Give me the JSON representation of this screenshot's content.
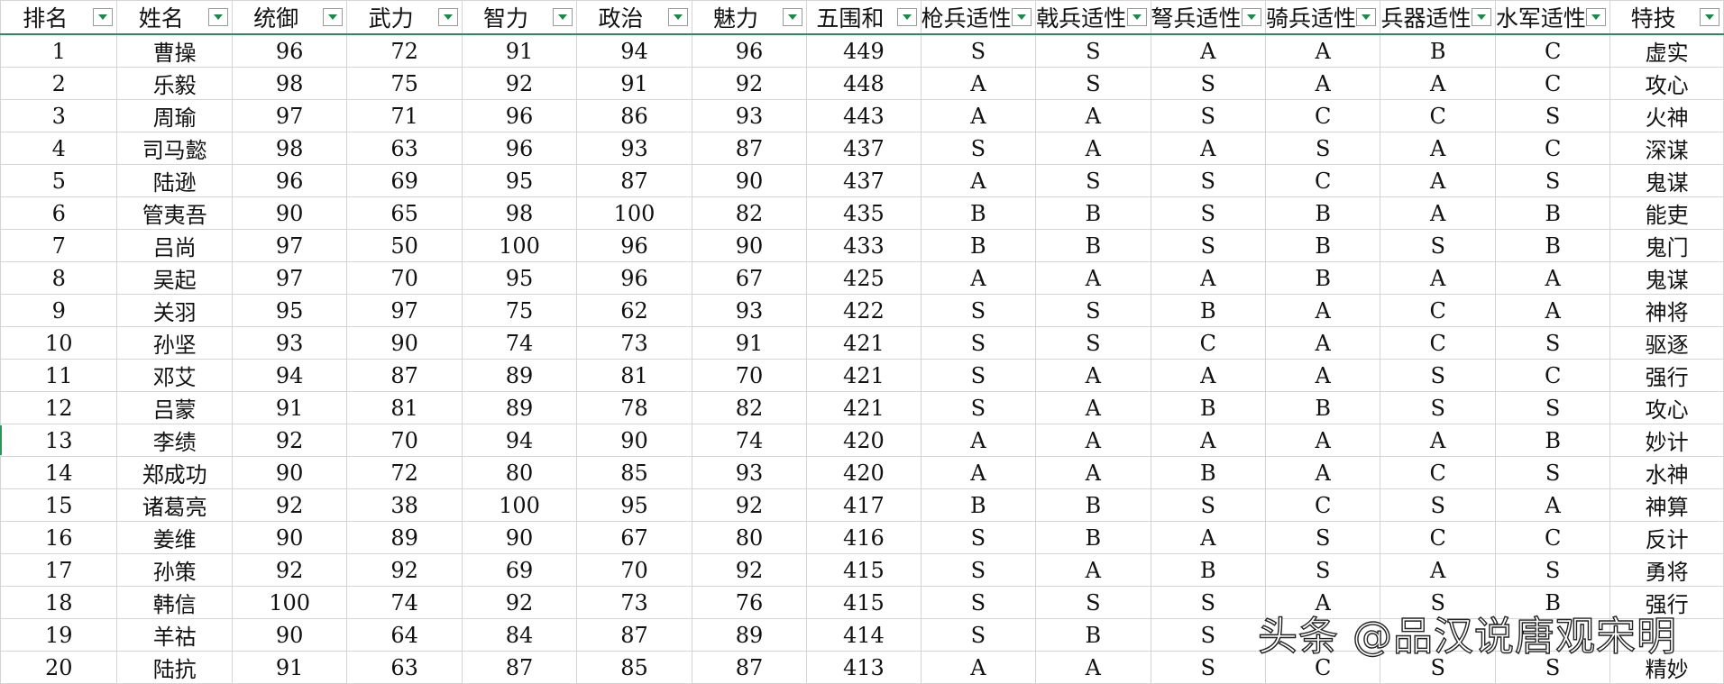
{
  "headers": [
    "排名",
    "姓名",
    "统御",
    "武力",
    "智力",
    "政治",
    "魅力",
    "五围和",
    "枪兵适性",
    "戟兵适性",
    "弩兵适性",
    "骑兵适性",
    "兵器适性",
    "水军适性",
    "特技"
  ],
  "rows": [
    [
      "1",
      "曹操",
      "96",
      "72",
      "91",
      "94",
      "96",
      "449",
      "S",
      "S",
      "A",
      "A",
      "B",
      "C",
      "虚实"
    ],
    [
      "2",
      "乐毅",
      "98",
      "75",
      "92",
      "91",
      "92",
      "448",
      "A",
      "S",
      "S",
      "A",
      "A",
      "C",
      "攻心"
    ],
    [
      "3",
      "周瑜",
      "97",
      "71",
      "96",
      "86",
      "93",
      "443",
      "A",
      "A",
      "S",
      "C",
      "C",
      "S",
      "火神"
    ],
    [
      "4",
      "司马懿",
      "98",
      "63",
      "96",
      "93",
      "87",
      "437",
      "S",
      "A",
      "A",
      "S",
      "A",
      "C",
      "深谋"
    ],
    [
      "5",
      "陆逊",
      "96",
      "69",
      "95",
      "87",
      "90",
      "437",
      "A",
      "S",
      "S",
      "C",
      "A",
      "S",
      "鬼谋"
    ],
    [
      "6",
      "管夷吾",
      "90",
      "65",
      "98",
      "100",
      "82",
      "435",
      "B",
      "B",
      "S",
      "B",
      "A",
      "B",
      "能吏"
    ],
    [
      "7",
      "吕尚",
      "97",
      "50",
      "100",
      "96",
      "90",
      "433",
      "B",
      "B",
      "S",
      "B",
      "S",
      "B",
      "鬼门"
    ],
    [
      "8",
      "吴起",
      "97",
      "70",
      "95",
      "96",
      "67",
      "425",
      "A",
      "A",
      "A",
      "B",
      "A",
      "A",
      "鬼谋"
    ],
    [
      "9",
      "关羽",
      "95",
      "97",
      "75",
      "62",
      "93",
      "422",
      "S",
      "S",
      "B",
      "A",
      "C",
      "A",
      "神将"
    ],
    [
      "10",
      "孙坚",
      "93",
      "90",
      "74",
      "73",
      "91",
      "421",
      "S",
      "S",
      "C",
      "A",
      "C",
      "S",
      "驱逐"
    ],
    [
      "11",
      "邓艾",
      "94",
      "87",
      "89",
      "81",
      "70",
      "421",
      "S",
      "A",
      "A",
      "A",
      "S",
      "C",
      "强行"
    ],
    [
      "12",
      "吕蒙",
      "91",
      "81",
      "89",
      "78",
      "82",
      "421",
      "S",
      "A",
      "B",
      "B",
      "S",
      "S",
      "攻心"
    ],
    [
      "13",
      "李绩",
      "92",
      "70",
      "94",
      "90",
      "74",
      "420",
      "A",
      "A",
      "A",
      "A",
      "A",
      "B",
      "妙计"
    ],
    [
      "14",
      "郑成功",
      "90",
      "72",
      "80",
      "85",
      "93",
      "420",
      "A",
      "A",
      "B",
      "A",
      "C",
      "S",
      "水神"
    ],
    [
      "15",
      "诸葛亮",
      "92",
      "38",
      "100",
      "95",
      "92",
      "417",
      "B",
      "B",
      "S",
      "C",
      "S",
      "A",
      "神算"
    ],
    [
      "16",
      "姜维",
      "90",
      "89",
      "90",
      "67",
      "80",
      "416",
      "S",
      "B",
      "A",
      "S",
      "C",
      "C",
      "反计"
    ],
    [
      "17",
      "孙策",
      "92",
      "92",
      "69",
      "70",
      "92",
      "415",
      "S",
      "A",
      "B",
      "S",
      "A",
      "S",
      "勇将"
    ],
    [
      "18",
      "韩信",
      "100",
      "74",
      "92",
      "73",
      "76",
      "415",
      "S",
      "S",
      "S",
      "A",
      "S",
      "B",
      "强行"
    ],
    [
      "19",
      "羊祜",
      "90",
      "64",
      "84",
      "87",
      "89",
      "414",
      "S",
      "B",
      "S",
      "",
      "",
      "",
      ""
    ],
    [
      "20",
      "陆抗",
      "91",
      "63",
      "87",
      "85",
      "87",
      "413",
      "A",
      "A",
      "S",
      "C",
      "S",
      "S",
      "精妙"
    ]
  ],
  "watermark": "头条 @品汉说唐观宋明",
  "colors": {
    "grid_line": "#d4d4d4",
    "header_underline": "#2e8b57",
    "filter_arrow": "#1a8a4a",
    "text": "#111111"
  },
  "icons": {
    "filter": "filter-dropdown-icon"
  }
}
